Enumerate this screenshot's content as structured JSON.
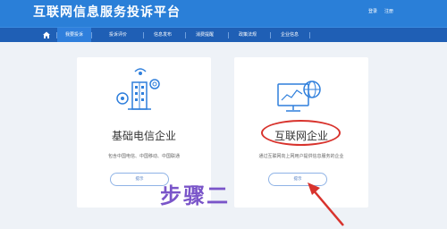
{
  "header": {
    "title": "互联网信息服务投诉平台",
    "login": "登录",
    "register": "注册"
  },
  "nav": {
    "home_icon": "home-icon",
    "items": [
      {
        "label": "我要投诉",
        "active": true
      },
      {
        "label": "投诉评价"
      },
      {
        "label": "信息发布"
      },
      {
        "label": "消费提醒"
      },
      {
        "label": "政策法规"
      },
      {
        "label": "企业信息"
      }
    ]
  },
  "cards": [
    {
      "icon": "telecom-building-icon",
      "title": "基础电信企业",
      "description": "包含中国电信、中国移动、中国联通",
      "button": "提示"
    },
    {
      "icon": "internet-monitor-icon",
      "title": "互联网企业",
      "description": "通过互联网向上网用户提供信息服务的企业",
      "button": "提示"
    }
  ],
  "annotation": {
    "step_text": "步骤二",
    "color": "#7a55c9",
    "highlight_color": "#d8332d"
  },
  "colors": {
    "header": "#2a7fd8",
    "nav": "#1f5fb5",
    "background": "#eef2f7"
  }
}
